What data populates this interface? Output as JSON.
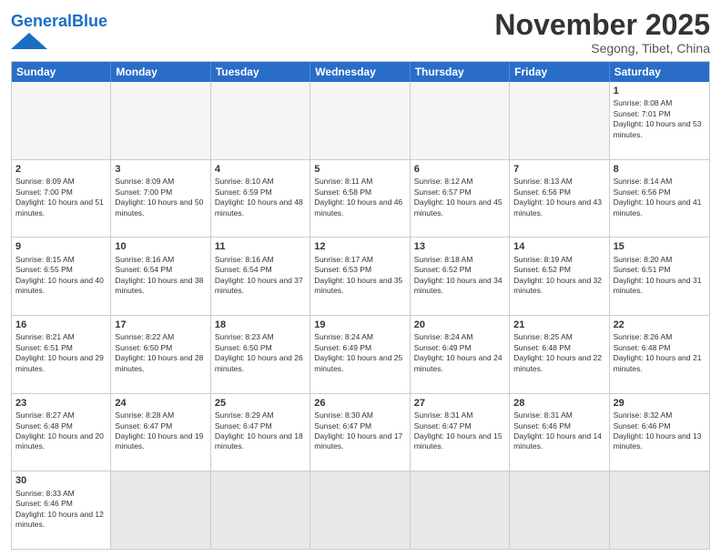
{
  "header": {
    "logo_general": "General",
    "logo_blue": "Blue",
    "month_title": "November 2025",
    "subtitle": "Segong, Tibet, China"
  },
  "weekdays": [
    "Sunday",
    "Monday",
    "Tuesday",
    "Wednesday",
    "Thursday",
    "Friday",
    "Saturday"
  ],
  "weeks": [
    [
      {
        "day": "",
        "info": "",
        "empty": true
      },
      {
        "day": "",
        "info": "",
        "empty": true
      },
      {
        "day": "",
        "info": "",
        "empty": true
      },
      {
        "day": "",
        "info": "",
        "empty": true
      },
      {
        "day": "",
        "info": "",
        "empty": true
      },
      {
        "day": "",
        "info": "",
        "empty": true
      },
      {
        "day": "1",
        "info": "Sunrise: 8:08 AM\nSunset: 7:01 PM\nDaylight: 10 hours and 53 minutes.",
        "empty": false
      }
    ],
    [
      {
        "day": "2",
        "info": "Sunrise: 8:09 AM\nSunset: 7:00 PM\nDaylight: 10 hours and 51 minutes.",
        "empty": false
      },
      {
        "day": "3",
        "info": "Sunrise: 8:09 AM\nSunset: 7:00 PM\nDaylight: 10 hours and 50 minutes.",
        "empty": false
      },
      {
        "day": "4",
        "info": "Sunrise: 8:10 AM\nSunset: 6:59 PM\nDaylight: 10 hours and 48 minutes.",
        "empty": false
      },
      {
        "day": "5",
        "info": "Sunrise: 8:11 AM\nSunset: 6:58 PM\nDaylight: 10 hours and 46 minutes.",
        "empty": false
      },
      {
        "day": "6",
        "info": "Sunrise: 8:12 AM\nSunset: 6:57 PM\nDaylight: 10 hours and 45 minutes.",
        "empty": false
      },
      {
        "day": "7",
        "info": "Sunrise: 8:13 AM\nSunset: 6:56 PM\nDaylight: 10 hours and 43 minutes.",
        "empty": false
      },
      {
        "day": "8",
        "info": "Sunrise: 8:14 AM\nSunset: 6:56 PM\nDaylight: 10 hours and 41 minutes.",
        "empty": false
      }
    ],
    [
      {
        "day": "9",
        "info": "Sunrise: 8:15 AM\nSunset: 6:55 PM\nDaylight: 10 hours and 40 minutes.",
        "empty": false
      },
      {
        "day": "10",
        "info": "Sunrise: 8:16 AM\nSunset: 6:54 PM\nDaylight: 10 hours and 38 minutes.",
        "empty": false
      },
      {
        "day": "11",
        "info": "Sunrise: 8:16 AM\nSunset: 6:54 PM\nDaylight: 10 hours and 37 minutes.",
        "empty": false
      },
      {
        "day": "12",
        "info": "Sunrise: 8:17 AM\nSunset: 6:53 PM\nDaylight: 10 hours and 35 minutes.",
        "empty": false
      },
      {
        "day": "13",
        "info": "Sunrise: 8:18 AM\nSunset: 6:52 PM\nDaylight: 10 hours and 34 minutes.",
        "empty": false
      },
      {
        "day": "14",
        "info": "Sunrise: 8:19 AM\nSunset: 6:52 PM\nDaylight: 10 hours and 32 minutes.",
        "empty": false
      },
      {
        "day": "15",
        "info": "Sunrise: 8:20 AM\nSunset: 6:51 PM\nDaylight: 10 hours and 31 minutes.",
        "empty": false
      }
    ],
    [
      {
        "day": "16",
        "info": "Sunrise: 8:21 AM\nSunset: 6:51 PM\nDaylight: 10 hours and 29 minutes.",
        "empty": false
      },
      {
        "day": "17",
        "info": "Sunrise: 8:22 AM\nSunset: 6:50 PM\nDaylight: 10 hours and 28 minutes.",
        "empty": false
      },
      {
        "day": "18",
        "info": "Sunrise: 8:23 AM\nSunset: 6:50 PM\nDaylight: 10 hours and 26 minutes.",
        "empty": false
      },
      {
        "day": "19",
        "info": "Sunrise: 8:24 AM\nSunset: 6:49 PM\nDaylight: 10 hours and 25 minutes.",
        "empty": false
      },
      {
        "day": "20",
        "info": "Sunrise: 8:24 AM\nSunset: 6:49 PM\nDaylight: 10 hours and 24 minutes.",
        "empty": false
      },
      {
        "day": "21",
        "info": "Sunrise: 8:25 AM\nSunset: 6:48 PM\nDaylight: 10 hours and 22 minutes.",
        "empty": false
      },
      {
        "day": "22",
        "info": "Sunrise: 8:26 AM\nSunset: 6:48 PM\nDaylight: 10 hours and 21 minutes.",
        "empty": false
      }
    ],
    [
      {
        "day": "23",
        "info": "Sunrise: 8:27 AM\nSunset: 6:48 PM\nDaylight: 10 hours and 20 minutes.",
        "empty": false
      },
      {
        "day": "24",
        "info": "Sunrise: 8:28 AM\nSunset: 6:47 PM\nDaylight: 10 hours and 19 minutes.",
        "empty": false
      },
      {
        "day": "25",
        "info": "Sunrise: 8:29 AM\nSunset: 6:47 PM\nDaylight: 10 hours and 18 minutes.",
        "empty": false
      },
      {
        "day": "26",
        "info": "Sunrise: 8:30 AM\nSunset: 6:47 PM\nDaylight: 10 hours and 17 minutes.",
        "empty": false
      },
      {
        "day": "27",
        "info": "Sunrise: 8:31 AM\nSunset: 6:47 PM\nDaylight: 10 hours and 15 minutes.",
        "empty": false
      },
      {
        "day": "28",
        "info": "Sunrise: 8:31 AM\nSunset: 6:46 PM\nDaylight: 10 hours and 14 minutes.",
        "empty": false
      },
      {
        "day": "29",
        "info": "Sunrise: 8:32 AM\nSunset: 6:46 PM\nDaylight: 10 hours and 13 minutes.",
        "empty": false
      }
    ],
    [
      {
        "day": "30",
        "info": "Sunrise: 8:33 AM\nSunset: 6:46 PM\nDaylight: 10 hours and 12 minutes.",
        "empty": false
      },
      {
        "day": "",
        "info": "",
        "empty": true
      },
      {
        "day": "",
        "info": "",
        "empty": true
      },
      {
        "day": "",
        "info": "",
        "empty": true
      },
      {
        "day": "",
        "info": "",
        "empty": true
      },
      {
        "day": "",
        "info": "",
        "empty": true
      },
      {
        "day": "",
        "info": "",
        "empty": true
      }
    ]
  ]
}
